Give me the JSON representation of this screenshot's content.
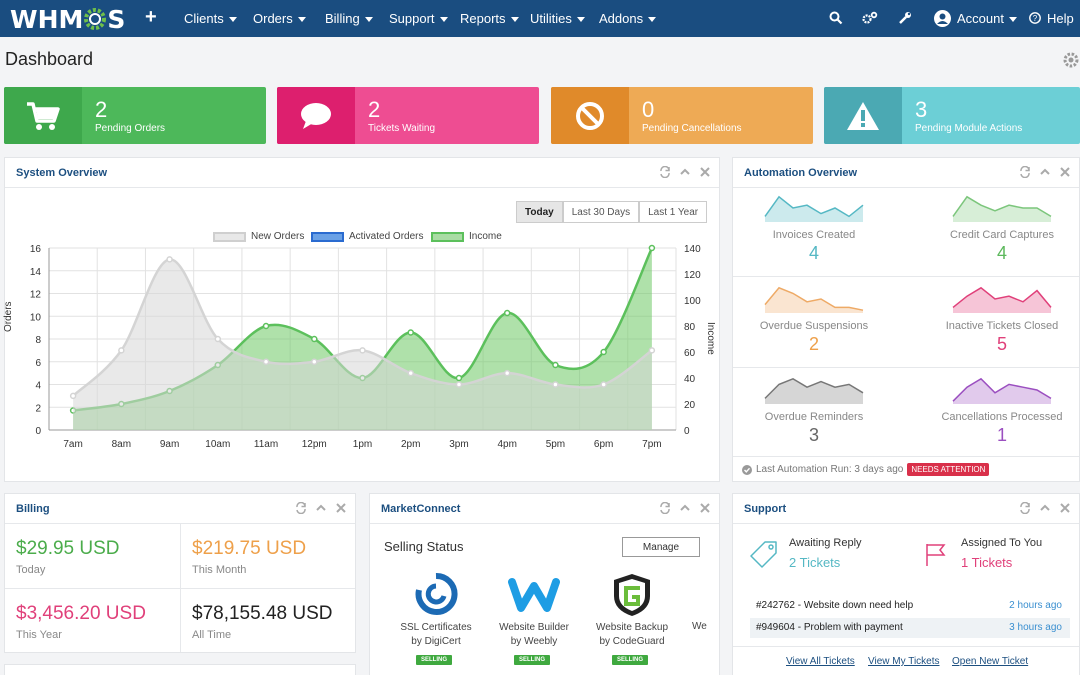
{
  "app": {
    "logo": "WHMCS"
  },
  "nav": {
    "items": [
      "Clients",
      "Orders",
      "Billing",
      "Support",
      "Reports",
      "Utilities",
      "Addons"
    ],
    "account": "Account",
    "help": "Help"
  },
  "page": {
    "title": "Dashboard"
  },
  "stats": [
    {
      "value": "2",
      "label": "Pending Orders",
      "color": "#4db85a",
      "icon_bg": "#3ea84c",
      "icon": "cart-icon"
    },
    {
      "value": "2",
      "label": "Tickets Waiting",
      "color": "#ee4d92",
      "icon_bg": "#dd1f6e",
      "icon": "speech-bubble-icon"
    },
    {
      "value": "0",
      "label": "Pending Cancellations",
      "color": "#eeaa55",
      "icon_bg": "#e08a2a",
      "icon": "ban-icon"
    },
    {
      "value": "3",
      "label": "Pending Module Actions",
      "color": "#6ccfd6",
      "icon_bg": "#4ba9b3",
      "icon": "warning-icon"
    }
  ],
  "system_overview": {
    "title": "System Overview",
    "ranges": [
      "Today",
      "Last 30 Days",
      "Last 1 Year"
    ],
    "active_range": "Today"
  },
  "chart_data": {
    "type": "line",
    "categories": [
      "7am",
      "8am",
      "9am",
      "10am",
      "11am",
      "12pm",
      "1pm",
      "2pm",
      "3pm",
      "4pm",
      "5pm",
      "6pm",
      "7pm"
    ],
    "series": [
      {
        "name": "New Orders",
        "axis": "left",
        "values": [
          3,
          7,
          15,
          8,
          6,
          6,
          7,
          5,
          4,
          5,
          4,
          4,
          7
        ],
        "color": "#c9c9c9"
      },
      {
        "name": "Activated Orders",
        "axis": "left",
        "values": [],
        "color": "#3b7dd8"
      },
      {
        "name": "Income",
        "axis": "right",
        "values": [
          15,
          20,
          30,
          50,
          80,
          70,
          40,
          75,
          40,
          90,
          50,
          60,
          140
        ],
        "color": "#5cc05c"
      }
    ],
    "ylabel": "Orders",
    "y2label": "Income",
    "ylim": [
      0,
      16
    ],
    "y2lim": [
      0,
      140
    ],
    "yticks": [
      0,
      2,
      4,
      6,
      8,
      10,
      12,
      14,
      16
    ],
    "y2ticks": [
      0,
      20,
      40,
      60,
      80,
      100,
      120,
      140
    ],
    "legend": "top"
  },
  "automation": {
    "title": "Automation Overview",
    "items": [
      {
        "label": "Invoices Created",
        "value": "4",
        "color": "#55b8c4"
      },
      {
        "label": "Credit Card Captures",
        "value": "4",
        "color": "#7cc67c"
      },
      {
        "label": "Overdue Suspensions",
        "value": "2",
        "color": "#eeaa66"
      },
      {
        "label": "Inactive Tickets Closed",
        "value": "5",
        "color": "#e0407a"
      },
      {
        "label": "Overdue Reminders",
        "value": "3",
        "color": "#777777"
      },
      {
        "label": "Cancellations Processed",
        "value": "1",
        "color": "#9b4fc0"
      }
    ],
    "last_run": "Last Automation Run: 3 days ago",
    "badge": "NEEDS ATTENTION"
  },
  "billing": {
    "title": "Billing",
    "today": {
      "value": "$29.95 USD",
      "label": "Today"
    },
    "month": {
      "value": "$219.75 USD",
      "label": "This Month"
    },
    "year": {
      "value": "$3,456.20 USD",
      "label": "This Year"
    },
    "all": {
      "value": "$78,155.48 USD",
      "label": "All Time"
    }
  },
  "marketconnect": {
    "title": "MarketConnect",
    "heading": "Selling Status",
    "manage": "Manage",
    "products": [
      {
        "line1": "SSL Certificates",
        "line2": "by DigiCert",
        "status": "SELLING"
      },
      {
        "line1": "Website Builder",
        "line2": "by Weebly",
        "status": "SELLING"
      },
      {
        "line1": "Website Backup",
        "line2": "by CodeGuard",
        "status": "SELLING"
      }
    ],
    "partial": "We"
  },
  "support": {
    "title": "Support",
    "awaiting": {
      "label": "Awaiting Reply",
      "value": "2 Tickets"
    },
    "assigned": {
      "label": "Assigned To You",
      "value": "1 Tickets"
    },
    "tickets": [
      {
        "text": "#242762 - Website down need help",
        "time": "2 hours ago"
      },
      {
        "text": "#949604 - Problem with payment",
        "time": "3 hours ago"
      }
    ],
    "links": [
      "View All Tickets",
      "View My Tickets",
      "Open New Ticket"
    ]
  }
}
